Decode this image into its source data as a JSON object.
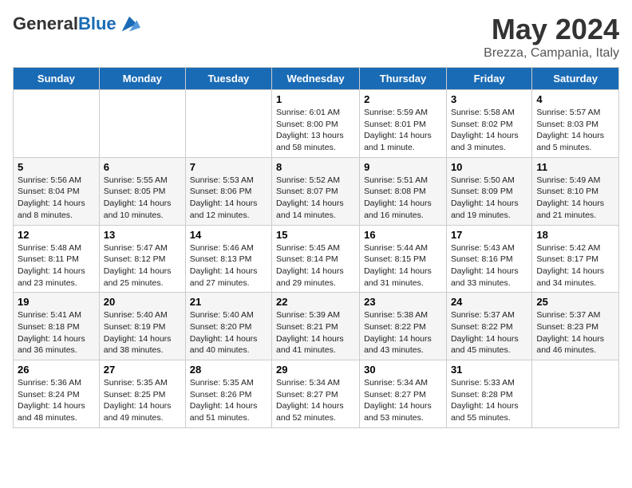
{
  "header": {
    "logo_general": "General",
    "logo_blue": "Blue",
    "title": "May 2024",
    "subtitle": "Brezza, Campania, Italy"
  },
  "days_of_week": [
    "Sunday",
    "Monday",
    "Tuesday",
    "Wednesday",
    "Thursday",
    "Friday",
    "Saturday"
  ],
  "weeks": [
    [
      {
        "day": "",
        "info": ""
      },
      {
        "day": "",
        "info": ""
      },
      {
        "day": "",
        "info": ""
      },
      {
        "day": "1",
        "info": "Sunrise: 6:01 AM\nSunset: 8:00 PM\nDaylight: 13 hours\nand 58 minutes."
      },
      {
        "day": "2",
        "info": "Sunrise: 5:59 AM\nSunset: 8:01 PM\nDaylight: 14 hours\nand 1 minute."
      },
      {
        "day": "3",
        "info": "Sunrise: 5:58 AM\nSunset: 8:02 PM\nDaylight: 14 hours\nand 3 minutes."
      },
      {
        "day": "4",
        "info": "Sunrise: 5:57 AM\nSunset: 8:03 PM\nDaylight: 14 hours\nand 5 minutes."
      }
    ],
    [
      {
        "day": "5",
        "info": "Sunrise: 5:56 AM\nSunset: 8:04 PM\nDaylight: 14 hours\nand 8 minutes."
      },
      {
        "day": "6",
        "info": "Sunrise: 5:55 AM\nSunset: 8:05 PM\nDaylight: 14 hours\nand 10 minutes."
      },
      {
        "day": "7",
        "info": "Sunrise: 5:53 AM\nSunset: 8:06 PM\nDaylight: 14 hours\nand 12 minutes."
      },
      {
        "day": "8",
        "info": "Sunrise: 5:52 AM\nSunset: 8:07 PM\nDaylight: 14 hours\nand 14 minutes."
      },
      {
        "day": "9",
        "info": "Sunrise: 5:51 AM\nSunset: 8:08 PM\nDaylight: 14 hours\nand 16 minutes."
      },
      {
        "day": "10",
        "info": "Sunrise: 5:50 AM\nSunset: 8:09 PM\nDaylight: 14 hours\nand 19 minutes."
      },
      {
        "day": "11",
        "info": "Sunrise: 5:49 AM\nSunset: 8:10 PM\nDaylight: 14 hours\nand 21 minutes."
      }
    ],
    [
      {
        "day": "12",
        "info": "Sunrise: 5:48 AM\nSunset: 8:11 PM\nDaylight: 14 hours\nand 23 minutes."
      },
      {
        "day": "13",
        "info": "Sunrise: 5:47 AM\nSunset: 8:12 PM\nDaylight: 14 hours\nand 25 minutes."
      },
      {
        "day": "14",
        "info": "Sunrise: 5:46 AM\nSunset: 8:13 PM\nDaylight: 14 hours\nand 27 minutes."
      },
      {
        "day": "15",
        "info": "Sunrise: 5:45 AM\nSunset: 8:14 PM\nDaylight: 14 hours\nand 29 minutes."
      },
      {
        "day": "16",
        "info": "Sunrise: 5:44 AM\nSunset: 8:15 PM\nDaylight: 14 hours\nand 31 minutes."
      },
      {
        "day": "17",
        "info": "Sunrise: 5:43 AM\nSunset: 8:16 PM\nDaylight: 14 hours\nand 33 minutes."
      },
      {
        "day": "18",
        "info": "Sunrise: 5:42 AM\nSunset: 8:17 PM\nDaylight: 14 hours\nand 34 minutes."
      }
    ],
    [
      {
        "day": "19",
        "info": "Sunrise: 5:41 AM\nSunset: 8:18 PM\nDaylight: 14 hours\nand 36 minutes."
      },
      {
        "day": "20",
        "info": "Sunrise: 5:40 AM\nSunset: 8:19 PM\nDaylight: 14 hours\nand 38 minutes."
      },
      {
        "day": "21",
        "info": "Sunrise: 5:40 AM\nSunset: 8:20 PM\nDaylight: 14 hours\nand 40 minutes."
      },
      {
        "day": "22",
        "info": "Sunrise: 5:39 AM\nSunset: 8:21 PM\nDaylight: 14 hours\nand 41 minutes."
      },
      {
        "day": "23",
        "info": "Sunrise: 5:38 AM\nSunset: 8:22 PM\nDaylight: 14 hours\nand 43 minutes."
      },
      {
        "day": "24",
        "info": "Sunrise: 5:37 AM\nSunset: 8:22 PM\nDaylight: 14 hours\nand 45 minutes."
      },
      {
        "day": "25",
        "info": "Sunrise: 5:37 AM\nSunset: 8:23 PM\nDaylight: 14 hours\nand 46 minutes."
      }
    ],
    [
      {
        "day": "26",
        "info": "Sunrise: 5:36 AM\nSunset: 8:24 PM\nDaylight: 14 hours\nand 48 minutes."
      },
      {
        "day": "27",
        "info": "Sunrise: 5:35 AM\nSunset: 8:25 PM\nDaylight: 14 hours\nand 49 minutes."
      },
      {
        "day": "28",
        "info": "Sunrise: 5:35 AM\nSunset: 8:26 PM\nDaylight: 14 hours\nand 51 minutes."
      },
      {
        "day": "29",
        "info": "Sunrise: 5:34 AM\nSunset: 8:27 PM\nDaylight: 14 hours\nand 52 minutes."
      },
      {
        "day": "30",
        "info": "Sunrise: 5:34 AM\nSunset: 8:27 PM\nDaylight: 14 hours\nand 53 minutes."
      },
      {
        "day": "31",
        "info": "Sunrise: 5:33 AM\nSunset: 8:28 PM\nDaylight: 14 hours\nand 55 minutes."
      },
      {
        "day": "",
        "info": ""
      }
    ]
  ]
}
